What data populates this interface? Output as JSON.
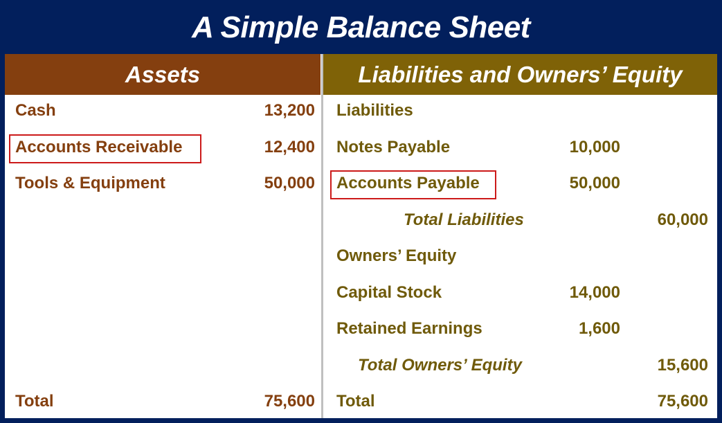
{
  "title": "A Simple Balance Sheet",
  "colors": {
    "frame": "#021f5c",
    "assets_header": "#843f0f",
    "liabilities_header": "#7f6207",
    "highlight_box": "#cc1a1a",
    "assets_text": "#843f0f",
    "liabilities_text": "#6f5a0a"
  },
  "assets": {
    "header": "Assets",
    "rows": [
      {
        "label": "Cash",
        "value": "13,200"
      },
      {
        "label": "Accounts Receivable",
        "value": "12,400",
        "highlighted": true
      },
      {
        "label": "Tools & Equipment",
        "value": "50,000"
      }
    ],
    "total": {
      "label": "Total",
      "value": "75,600"
    }
  },
  "liabilities_equity": {
    "header": "Liabilities and Owners’ Equity",
    "liabilities_label": "Liabilities",
    "liabilities": [
      {
        "label": "Notes Payable",
        "value": "10,000"
      },
      {
        "label": "Accounts Payable",
        "value": "50,000",
        "highlighted": true
      }
    ],
    "total_liabilities": {
      "label": "Total Liabilities",
      "value": "60,000"
    },
    "equity_label": "Owners’ Equity",
    "equity": [
      {
        "label": "Capital Stock",
        "value": "14,000"
      },
      {
        "label": "Retained Earnings",
        "value": "1,600"
      }
    ],
    "total_equity": {
      "label": "Total Owners’ Equity",
      "value": "15,600"
    },
    "total": {
      "label": "Total",
      "value": "75,600"
    }
  }
}
